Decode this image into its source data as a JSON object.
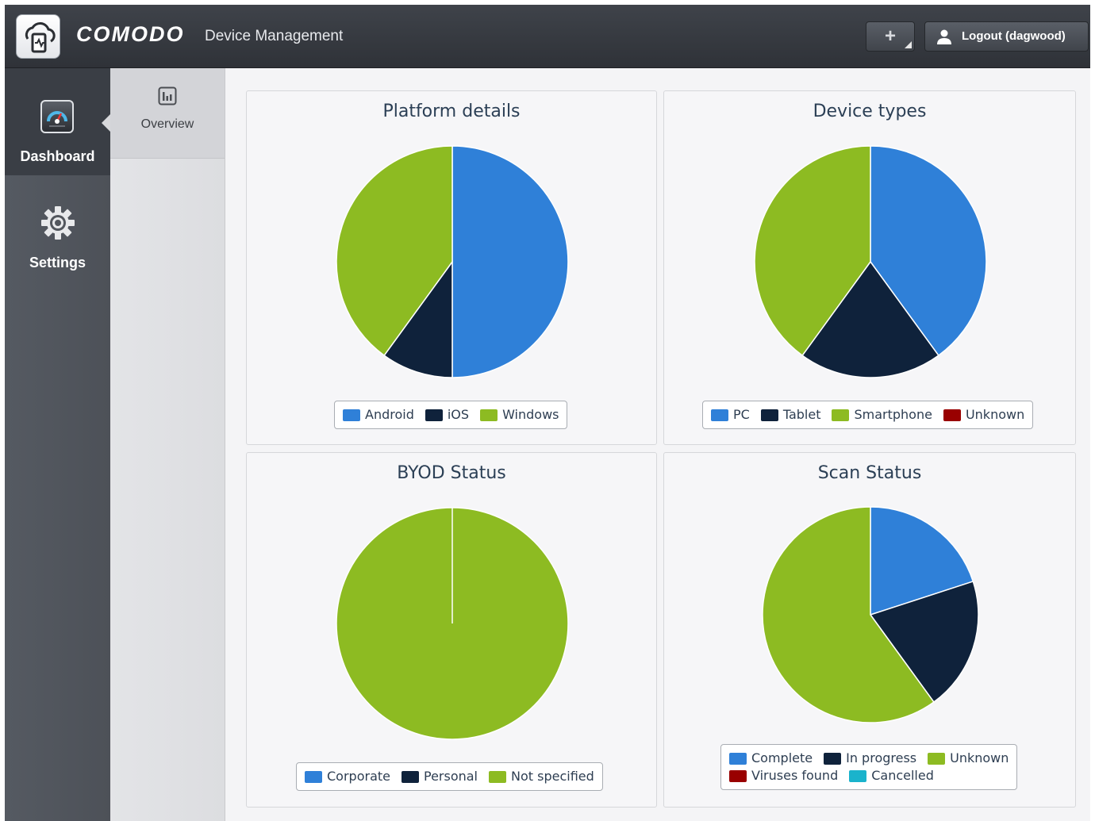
{
  "header": {
    "brand": "COMODO",
    "product": "Device Management",
    "add_button": "+",
    "logout_label": "Logout (dagwood)"
  },
  "leftnav": {
    "dashboard_label": "Dashboard",
    "settings_label": "Settings"
  },
  "subnav": {
    "overview_label": "Overview"
  },
  "colors": {
    "blue": "#2f80d8",
    "navy": "#0f223b",
    "green": "#8dbb22",
    "darkred": "#990000",
    "cyan": "#1ab3cc"
  },
  "chart_data": [
    {
      "type": "pie",
      "title": "Platform details",
      "legend": "bottom",
      "series": [
        {
          "name": "Android",
          "value": 50,
          "color": "#2f80d8"
        },
        {
          "name": "iOS",
          "value": 10,
          "color": "#0f223b"
        },
        {
          "name": "Windows",
          "value": 40,
          "color": "#8dbb22"
        }
      ]
    },
    {
      "type": "pie",
      "title": "Device types",
      "legend": "bottom",
      "series": [
        {
          "name": "PC",
          "value": 40,
          "color": "#2f80d8"
        },
        {
          "name": "Tablet",
          "value": 20,
          "color": "#0f223b"
        },
        {
          "name": "Smartphone",
          "value": 40,
          "color": "#8dbb22"
        },
        {
          "name": "Unknown",
          "value": 0,
          "color": "#990000"
        }
      ]
    },
    {
      "type": "pie",
      "title": "BYOD Status",
      "legend": "bottom",
      "series": [
        {
          "name": "Corporate",
          "value": 0,
          "color": "#2f80d8"
        },
        {
          "name": "Personal",
          "value": 0,
          "color": "#0f223b"
        },
        {
          "name": "Not specified",
          "value": 100,
          "color": "#8dbb22"
        }
      ]
    },
    {
      "type": "pie",
      "title": "Scan Status",
      "legend": "bottom",
      "series": [
        {
          "name": "Complete",
          "value": 20,
          "color": "#2f80d8"
        },
        {
          "name": "In progress",
          "value": 20,
          "color": "#0f223b"
        },
        {
          "name": "Unknown",
          "value": 60,
          "color": "#8dbb22"
        },
        {
          "name": "Viruses found",
          "value": 0,
          "color": "#990000"
        },
        {
          "name": "Cancelled",
          "value": 0,
          "color": "#1ab3cc"
        }
      ]
    }
  ]
}
